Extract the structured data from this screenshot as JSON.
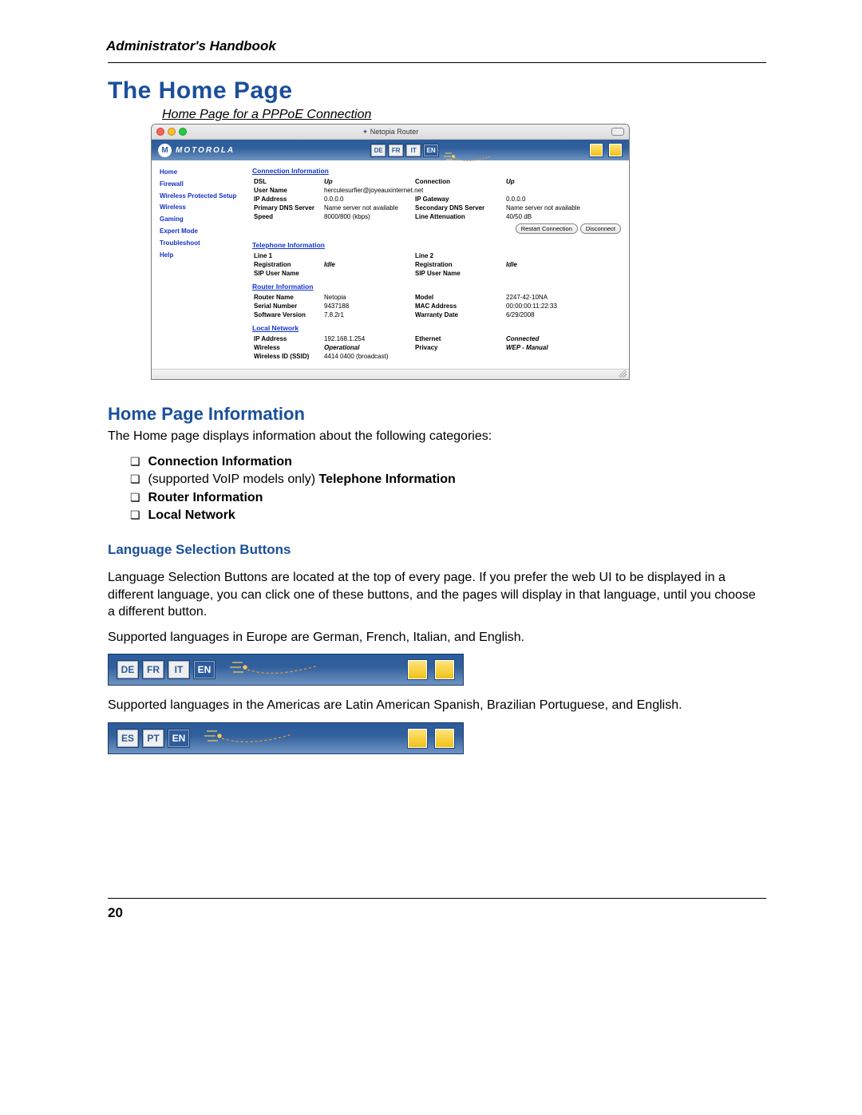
{
  "header": {
    "running_head": "Administrator's Handbook"
  },
  "section_title": "The Home Page",
  "caption": "Home Page for a PPPoE Connection",
  "window": {
    "title": "Netopia Router",
    "brand": "MOTOROLA",
    "lang_buttons": [
      "DE",
      "FR",
      "IT",
      "EN"
    ],
    "nav": [
      "Home",
      "Firewall",
      "Wireless Protected Setup",
      "Wireless",
      "Gaming",
      "Expert Mode",
      "Troubleshoot",
      "Help"
    ],
    "groups": {
      "connection": {
        "title": "Connection Information",
        "rows": [
          {
            "l1": "DSL",
            "v1": "Up",
            "cls1": "up",
            "l2": "Connection",
            "v2": "Up",
            "cls2": "up"
          },
          {
            "l1": "User Name",
            "v1": "herculesurfier@joyeauxinternet.net",
            "span": true
          },
          {
            "l1": "IP Address",
            "v1": "0.0.0.0",
            "l2": "IP Gateway",
            "v2": "0.0.0.0"
          },
          {
            "l1": "Primary DNS Server",
            "v1": "Name server not available",
            "l2": "Secondary DNS Server",
            "v2": "Name server not available"
          },
          {
            "l1": "Speed",
            "v1": "8000/800 (kbps)",
            "l2": "Line Attenuation",
            "v2": "40/50 dB"
          }
        ],
        "buttons": [
          "Restart Connection",
          "Disconnect"
        ]
      },
      "telephone": {
        "title": "Telephone Information",
        "rows": [
          {
            "l1": "Line 1",
            "v1": "",
            "l2": "Line 2",
            "v2": ""
          },
          {
            "l1": "Registration",
            "v1": "Idle",
            "cls1": "idle",
            "l2": "Registration",
            "v2": "Idle",
            "cls2": "idle"
          },
          {
            "l1": "SIP User Name",
            "v1": "",
            "l2": "SIP User Name",
            "v2": ""
          }
        ]
      },
      "router": {
        "title": "Router Information",
        "rows": [
          {
            "l1": "Router Name",
            "v1": "Netopia",
            "l2": "Model",
            "v2": "2247-42-10NA"
          },
          {
            "l1": "Serial Number",
            "v1": "9437188",
            "l2": "MAC Address",
            "v2": "00:00:00:11:22:33"
          },
          {
            "l1": "Software Version",
            "v1": "7.8.2r1",
            "l2": "Warranty Date",
            "v2": "6/29/2008"
          }
        ]
      },
      "local": {
        "title": "Local Network",
        "rows": [
          {
            "l1": "IP Address",
            "v1": "192.168.1.254",
            "l2": "Ethernet",
            "v2": "Connected",
            "cls2": "statOp"
          },
          {
            "l1": "Wireless",
            "v1": "Operational",
            "cls1": "statOp",
            "l2": "Privacy",
            "v2": "WEP - Manual",
            "cls2": "statOp"
          },
          {
            "l1": "Wireless ID (SSID)",
            "v1": "4414 0400 (broadcast)"
          }
        ]
      }
    }
  },
  "info_heading": "Home Page Information",
  "info_lead": "The Home page displays information about the following categories:",
  "info_items": [
    {
      "text": "Connection Information",
      "bold": true
    },
    {
      "pre": "(supported VoIP models only) ",
      "bold_suffix": "Telephone Information"
    },
    {
      "text": "Router Information",
      "bold": true
    },
    {
      "text": "Local Network",
      "bold": true
    }
  ],
  "lang_heading": "Language Selection Buttons",
  "lang_p1": "Language Selection Buttons are located at the top of every page. If you prefer the web UI to be displayed in a different language, you can click one of these buttons, and the pages will display in that language, until you choose a different button.",
  "lang_p2": "Supported languages in Europe are German, French, Italian, and English.",
  "lang_bar1": [
    "DE",
    "FR",
    "IT",
    "EN"
  ],
  "lang_p3": "Supported languages in the Americas are Latin American Spanish, Brazilian Portuguese, and English.",
  "lang_bar2": [
    "ES",
    "PT",
    "EN"
  ],
  "page_number": "20"
}
